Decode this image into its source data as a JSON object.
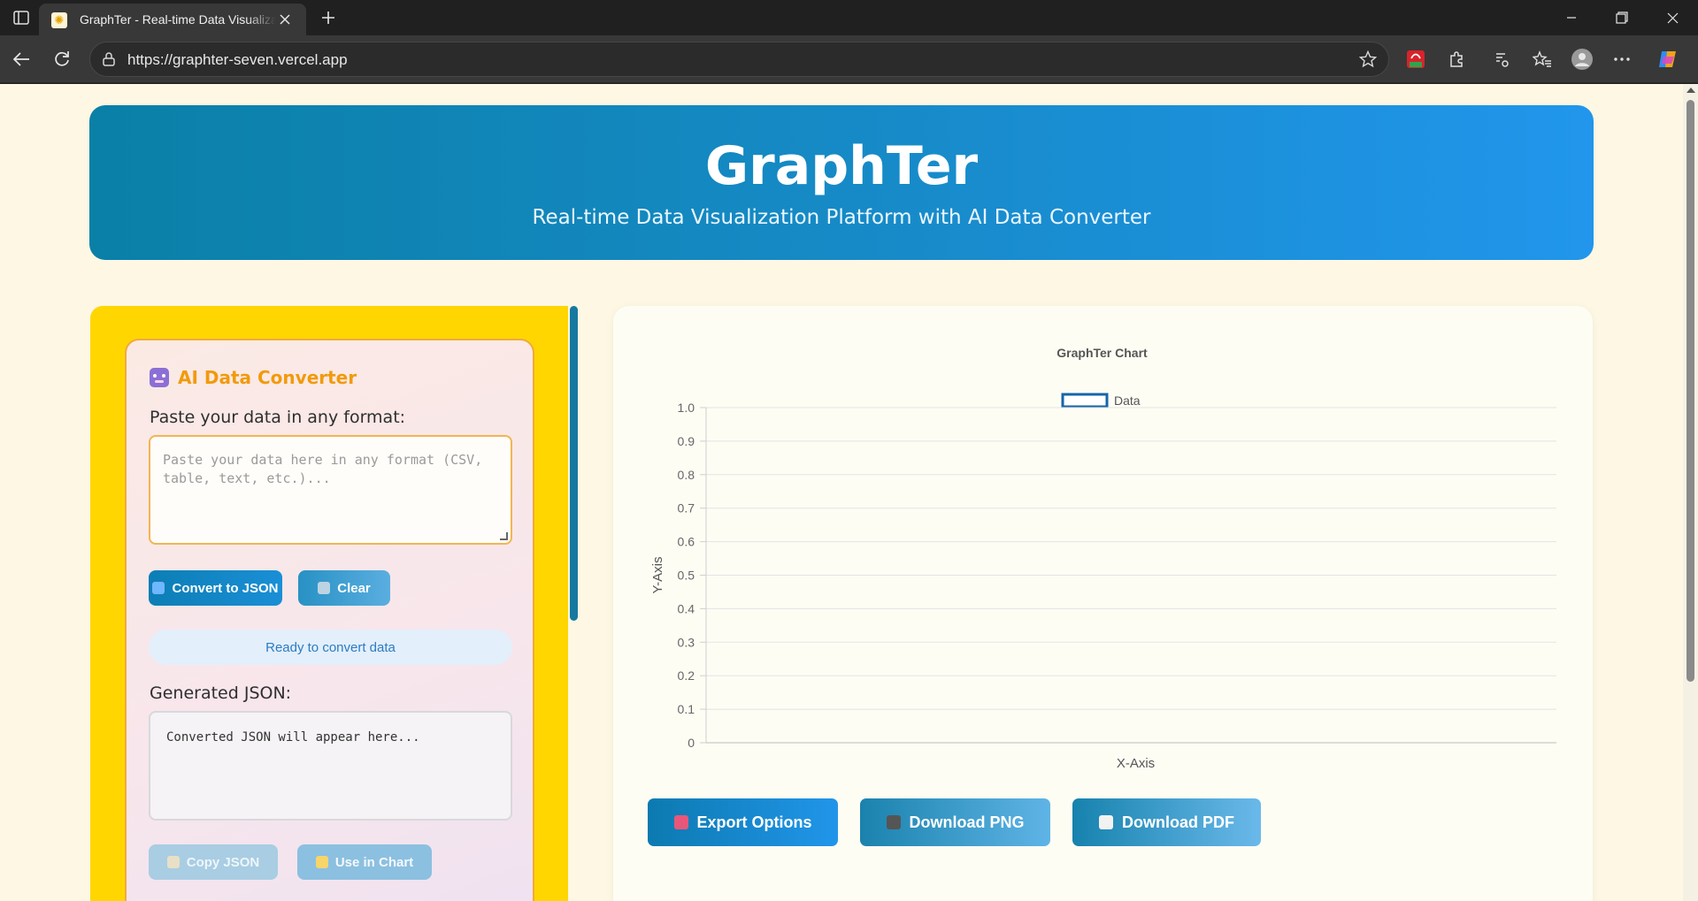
{
  "browser": {
    "tab_title": "GraphTer - Real-time Data Visualization Platform",
    "url": "https://graphter-seven.vercel.app"
  },
  "header": {
    "title": "GraphTer",
    "subtitle": "Real-time Data Visualization Platform with AI Data Converter"
  },
  "converter": {
    "title": "AI Data Converter",
    "input_label": "Paste your data in any format:",
    "input_placeholder": "Paste your data here in any format (CSV, table, text, etc.)...",
    "convert_label": "Convert to JSON",
    "clear_label": "Clear",
    "status": "Ready to convert data",
    "output_label": "Generated JSON:",
    "output_placeholder": "Converted JSON will appear here...",
    "copy_label": "Copy JSON",
    "use_label": "Use in Chart"
  },
  "chart_data": {
    "type": "line",
    "title": "GraphTer Chart",
    "series": [
      {
        "name": "Data",
        "values": [],
        "color": "#1565a8"
      }
    ],
    "xlabel": "X-Axis",
    "ylabel": "Y-Axis",
    "ylim": [
      0,
      1
    ],
    "y_ticks": [
      "0",
      "0.1",
      "0.2",
      "0.3",
      "0.4",
      "0.5",
      "0.6",
      "0.7",
      "0.8",
      "0.9",
      "1.0"
    ],
    "grid": true,
    "legend": "top-center"
  },
  "actions": {
    "export_label": "Export Options",
    "png_label": "Download PNG",
    "pdf_label": "Download PDF"
  },
  "colors": {
    "page_bg": "#fdf7e3",
    "header_gradient_start": "#0a80a7",
    "header_gradient_end": "#2196ec",
    "panel_yellow": "#ffd600",
    "converter_title": "#f29a0b"
  }
}
